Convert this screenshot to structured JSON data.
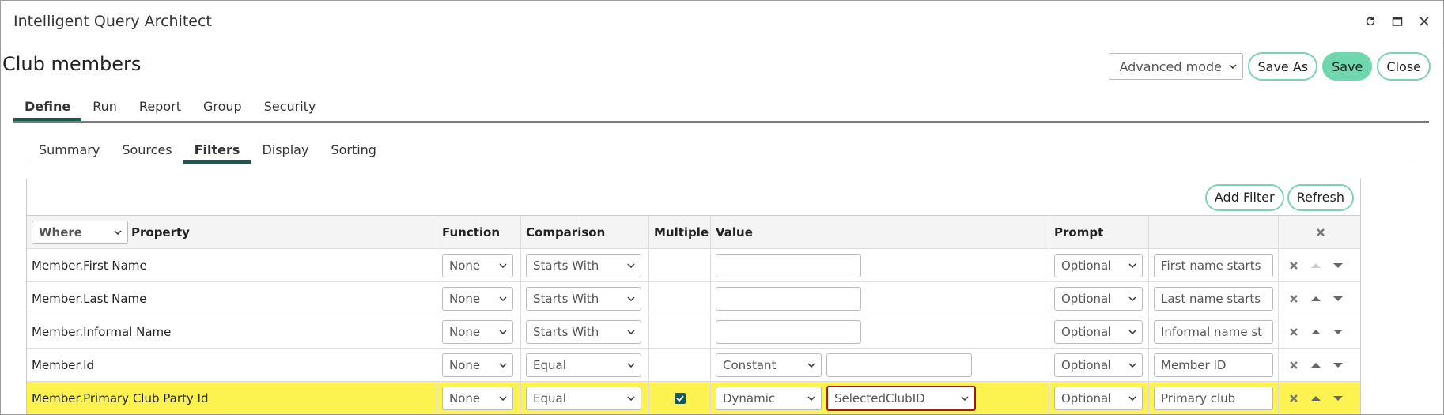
{
  "window": {
    "title": "Intelligent Query Architect"
  },
  "page": {
    "title": "Club members"
  },
  "toolbar": {
    "mode": "Advanced mode",
    "save_as": "Save As",
    "save": "Save",
    "close": "Close"
  },
  "tabs": [
    "Define",
    "Run",
    "Report",
    "Group",
    "Security"
  ],
  "subtabs": [
    "Summary",
    "Sources",
    "Filters",
    "Display",
    "Sorting"
  ],
  "filters": {
    "add_filter": "Add Filter",
    "refresh": "Refresh",
    "header": {
      "where": "Where",
      "property": "Property",
      "function": "Function",
      "comparison": "Comparison",
      "multiple": "Multiple",
      "value": "Value",
      "prompt": "Prompt"
    },
    "rows": [
      {
        "property": "Member.First Name",
        "function": "None",
        "comparison": "Starts With",
        "value": "",
        "prompt": "Optional",
        "label": "First name starts"
      },
      {
        "property": "Member.Last Name",
        "function": "None",
        "comparison": "Starts With",
        "value": "",
        "prompt": "Optional",
        "label": "Last name starts"
      },
      {
        "property": "Member.Informal Name",
        "function": "None",
        "comparison": "Starts With",
        "value": "",
        "prompt": "Optional",
        "label": "Informal name st"
      },
      {
        "property": "Member.Id",
        "function": "None",
        "comparison": "Equal",
        "value_type": "Constant",
        "value": "",
        "prompt": "Optional",
        "label": "Member ID"
      },
      {
        "property": "Member.Primary Club Party Id",
        "function": "None",
        "comparison": "Equal",
        "multiple": true,
        "value_type": "Dynamic",
        "value": "SelectedClubID",
        "prompt": "Optional",
        "label": "Primary club"
      }
    ]
  },
  "colors": {
    "accent": "#1a5a4e",
    "pill_border": "#7dd3b0",
    "save_bg": "#6fd6ad",
    "highlight": "#fdf350",
    "red_outline": "#a01c1c"
  }
}
